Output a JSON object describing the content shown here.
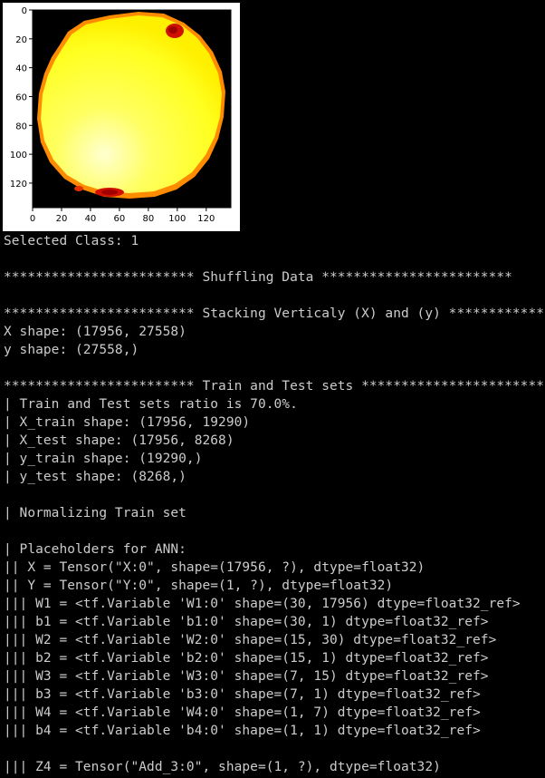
{
  "image_plot": {
    "y_ticks": [
      "0",
      "20",
      "40",
      "60",
      "80",
      "100",
      "120"
    ],
    "x_ticks": [
      "0",
      "20",
      "40",
      "60",
      "80",
      "100",
      "120"
    ],
    "colormap": "hot",
    "colors": {
      "fill": "#ffff30",
      "highlight": "#ffffc8",
      "edge": "#ff9a00",
      "spot": "#c80000",
      "background": "#ffffff"
    }
  },
  "console": {
    "lines": [
      "Selected Class: 1",
      "",
      "************************ Shuffling Data ************************",
      "",
      "************************ Stacking Verticaly (X) and (y) ************************",
      "X shape: (17956, 27558)",
      "y shape: (27558,)",
      "",
      "************************ Train and Test sets ************************",
      "| Train and Test sets ratio is 70.0%.",
      "| X_train shape: (17956, 19290)",
      "| X_test shape: (17956, 8268)",
      "| y_train shape: (19290,)",
      "| y_test shape: (8268,)",
      "",
      "| Normalizing Train set",
      "",
      "| Placeholders for ANN:",
      "|| X = Tensor(\"X:0\", shape=(17956, ?), dtype=float32)",
      "|| Y = Tensor(\"Y:0\", shape=(1, ?), dtype=float32)",
      "||| W1 = <tf.Variable 'W1:0' shape=(30, 17956) dtype=float32_ref>",
      "||| b1 = <tf.Variable 'b1:0' shape=(30, 1) dtype=float32_ref>",
      "||| W2 = <tf.Variable 'W2:0' shape=(15, 30) dtype=float32_ref>",
      "||| b2 = <tf.Variable 'b2:0' shape=(15, 1) dtype=float32_ref>",
      "||| W3 = <tf.Variable 'W3:0' shape=(7, 15) dtype=float32_ref>",
      "||| b3 = <tf.Variable 'b3:0' shape=(7, 1) dtype=float32_ref>",
      "||| W4 = <tf.Variable 'W4:0' shape=(1, 7) dtype=float32_ref>",
      "||| b4 = <tf.Variable 'b4:0' shape=(1, 1) dtype=float32_ref>",
      "",
      "||| Z4 = Tensor(\"Add_3:0\", shape=(1, ?), dtype=float32)"
    ]
  }
}
